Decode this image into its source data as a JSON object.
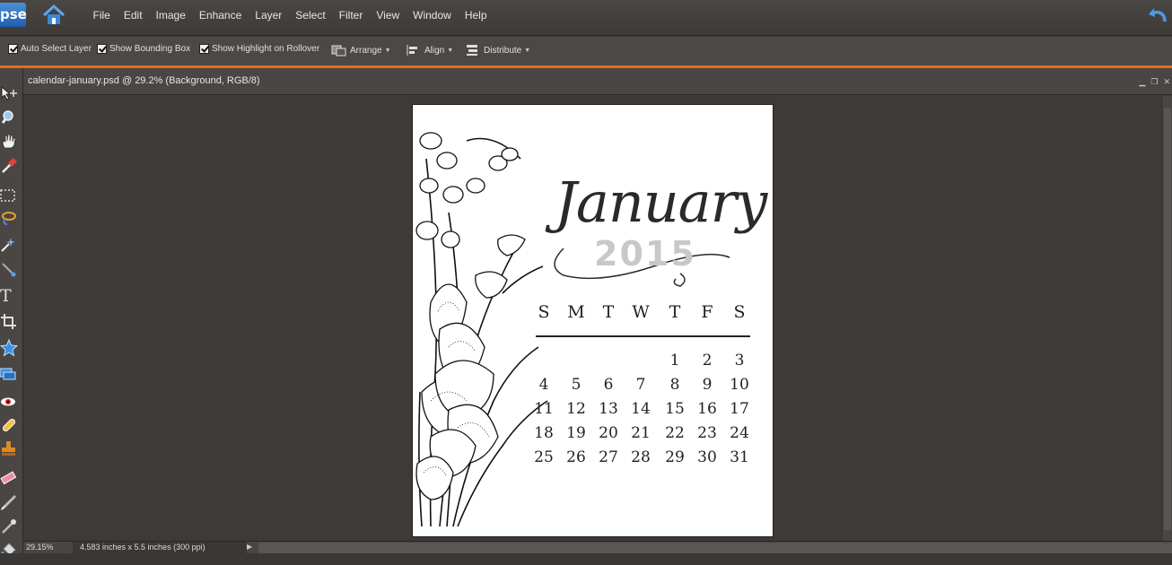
{
  "app": {
    "logo": "pse",
    "menu": [
      "File",
      "Edit",
      "Image",
      "Enhance",
      "Layer",
      "Select",
      "Filter",
      "View",
      "Window",
      "Help"
    ]
  },
  "options": {
    "auto_select_layer": "Auto Select Layer",
    "show_bounding_box": "Show Bounding Box",
    "show_highlight": "Show Highlight on Rollover",
    "arrange": "Arrange",
    "align": "Align",
    "distribute": "Distribute"
  },
  "document": {
    "title": "calendar-january.psd @ 29.2% (Background, RGB/8)",
    "zoom": "29.15%",
    "dimensions": "4.583 inches x 5.5 inches (300 ppi)"
  },
  "calendar": {
    "month": "January",
    "year": "2015",
    "weekdays": [
      "S",
      "M",
      "T",
      "W",
      "T",
      "F",
      "S"
    ],
    "weeks": [
      [
        "",
        "",
        "",
        "",
        "1",
        "2",
        "3"
      ],
      [
        "4",
        "5",
        "6",
        "7",
        "8",
        "9",
        "10"
      ],
      [
        "11",
        "12",
        "13",
        "14",
        "15",
        "16",
        "17"
      ],
      [
        "18",
        "19",
        "20",
        "21",
        "22",
        "23",
        "24"
      ],
      [
        "25",
        "26",
        "27",
        "28",
        "29",
        "30",
        "31"
      ]
    ]
  },
  "tools": [
    "move-tool-icon",
    "zoom-tool-icon",
    "hand-tool-icon",
    "eyedropper-tool-icon",
    "marquee-tool-icon",
    "lasso-tool-icon",
    "magic-wand-tool-icon",
    "quick-selection-tool-icon",
    "type-tool-icon",
    "crop-tool-icon",
    "cookie-cutter-tool-icon",
    "straighten-tool-icon",
    "red-eye-tool-icon",
    "healing-brush-tool-icon",
    "clone-stamp-tool-icon",
    "eraser-tool-icon",
    "brush-tool-icon",
    "smart-brush-tool-icon",
    "paint-bucket-tool-icon"
  ],
  "colors": {
    "accent": "#e8691c",
    "logo_blue": "#2a6fc4"
  }
}
